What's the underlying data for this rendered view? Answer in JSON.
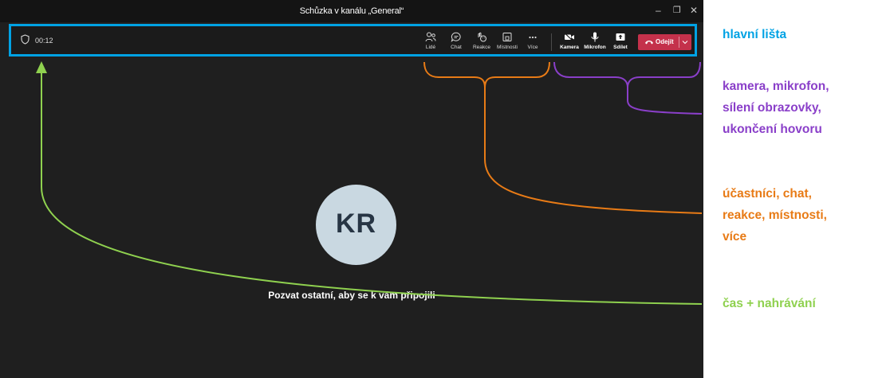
{
  "window": {
    "title": "Schůzka v kanálu „General“",
    "controls": {
      "minimize": "–",
      "maximize": "❐",
      "close": "✕"
    }
  },
  "toolbar": {
    "timer": "00:12",
    "buttons": [
      {
        "label": "Lidé",
        "icon": "people-icon"
      },
      {
        "label": "Chat",
        "icon": "chat-icon"
      },
      {
        "label": "Reakce",
        "icon": "reaction-icon"
      },
      {
        "label": "Místnosti",
        "icon": "rooms-icon"
      },
      {
        "label": "Více",
        "icon": "more-icon"
      },
      {
        "label": "Kamera",
        "icon": "camera-icon"
      },
      {
        "label": "Mikrofon",
        "icon": "microphone-icon"
      },
      {
        "label": "Sdílet",
        "icon": "share-icon"
      }
    ],
    "leave_label": "Odejít"
  },
  "stage": {
    "avatar_initials": "KR",
    "invite_text": "Pozvat ostatní, aby se k vám připojili"
  },
  "annotations": {
    "main_bar": "hlavní lišta",
    "camera_group": [
      "kamera, mikrofon,",
      "sílení obrazovky,",
      "ukončení hovoru"
    ],
    "participants_group": [
      "účastníci, chat,",
      "reakce, místnosti,",
      "více"
    ],
    "time_group": "čas + nahrávání"
  },
  "colors": {
    "frame": "#00a2e4",
    "purple": "#8a3fc9",
    "orange": "#e87b16",
    "green": "#8fd14f",
    "leave": "#c4314b",
    "background": "#1f1f1f"
  }
}
